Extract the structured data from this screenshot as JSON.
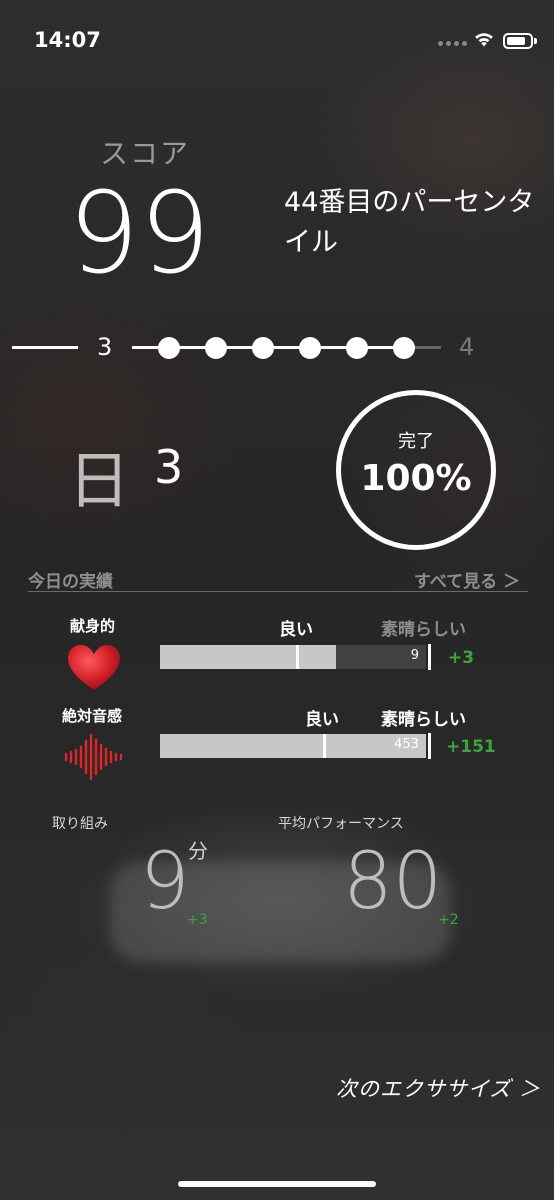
{
  "status_bar": {
    "time": "14:07"
  },
  "score": {
    "label": "スコア",
    "value": "99",
    "percentile": "44番目のパーセンタイル"
  },
  "level": {
    "current": "3",
    "next": "4",
    "progress_dots": 6
  },
  "day": {
    "label": "日",
    "value": "3"
  },
  "completion": {
    "label": "完了",
    "value": "100%"
  },
  "achievements": {
    "title": "今日の実績",
    "see_all": "すべて見る ＞",
    "skills": [
      {
        "name": "献身的",
        "icon": "heart-icon",
        "tier_good": "良い",
        "tier_great": "素晴らしい",
        "value": "9",
        "delta": "+3",
        "fill": 0.56,
        "mark": 0.42
      },
      {
        "name": "絶対音感",
        "icon": "sound-wave-icon",
        "tier_good": "良い",
        "tier_great": "素晴らしい",
        "value": "453",
        "delta": "+151",
        "fill": 1.0,
        "mark": 0.61
      }
    ]
  },
  "stats": {
    "engagement": {
      "label": "取り組み",
      "value": "9",
      "unit": "分",
      "delta": "+3"
    },
    "avg_performance": {
      "label": "平均パフォーマンス",
      "value": "80",
      "delta": "+2"
    }
  },
  "next_exercise": "次のエクササイズ ＞",
  "colors": {
    "positive": "#3ea53e",
    "bar_fill": "#c7c7c7",
    "bar_track": "#414141"
  }
}
